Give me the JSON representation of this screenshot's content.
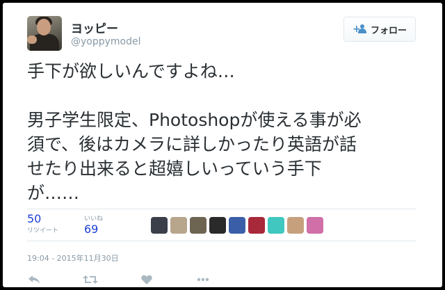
{
  "tweet": {
    "display_name": "ヨッピー",
    "screen_name": "@yoppymodel",
    "follow_label": "フォロー",
    "text_line1": "手下が欲しいんですよね…",
    "text_body": "男子学生限定、Photoshopが使える事が必\n須で、後はカメラに詳しかったり英語が話\nせたり出来ると超嬉しいっていう手下\nが……",
    "timestamp": "19:04 - 2015年11月30日"
  },
  "stats": {
    "retweets": {
      "value": "50",
      "label": "リツイート"
    },
    "likes": {
      "value": "69",
      "label": "いいね"
    }
  },
  "liker_avatars": [
    {
      "icon": "avatar-dark-figure",
      "color": "#3a3f4a"
    },
    {
      "icon": "avatar-character",
      "color": "#b7a58c"
    },
    {
      "icon": "avatar-photo",
      "color": "#6d6452"
    },
    {
      "icon": "avatar-dog",
      "color": "#2a2a2a"
    },
    {
      "icon": "avatar-blue-anime",
      "color": "#3a5fa8"
    },
    {
      "icon": "avatar-red-anime",
      "color": "#a8293a"
    },
    {
      "icon": "avatar-teal-anime",
      "color": "#3fc7c0"
    },
    {
      "icon": "avatar-person",
      "color": "#c6a07d"
    },
    {
      "icon": "avatar-pink",
      "color": "#d06fa8"
    }
  ],
  "colors": {
    "link_blue": "#1b3dd4",
    "muted": "#8899a6",
    "text": "#292f33"
  }
}
